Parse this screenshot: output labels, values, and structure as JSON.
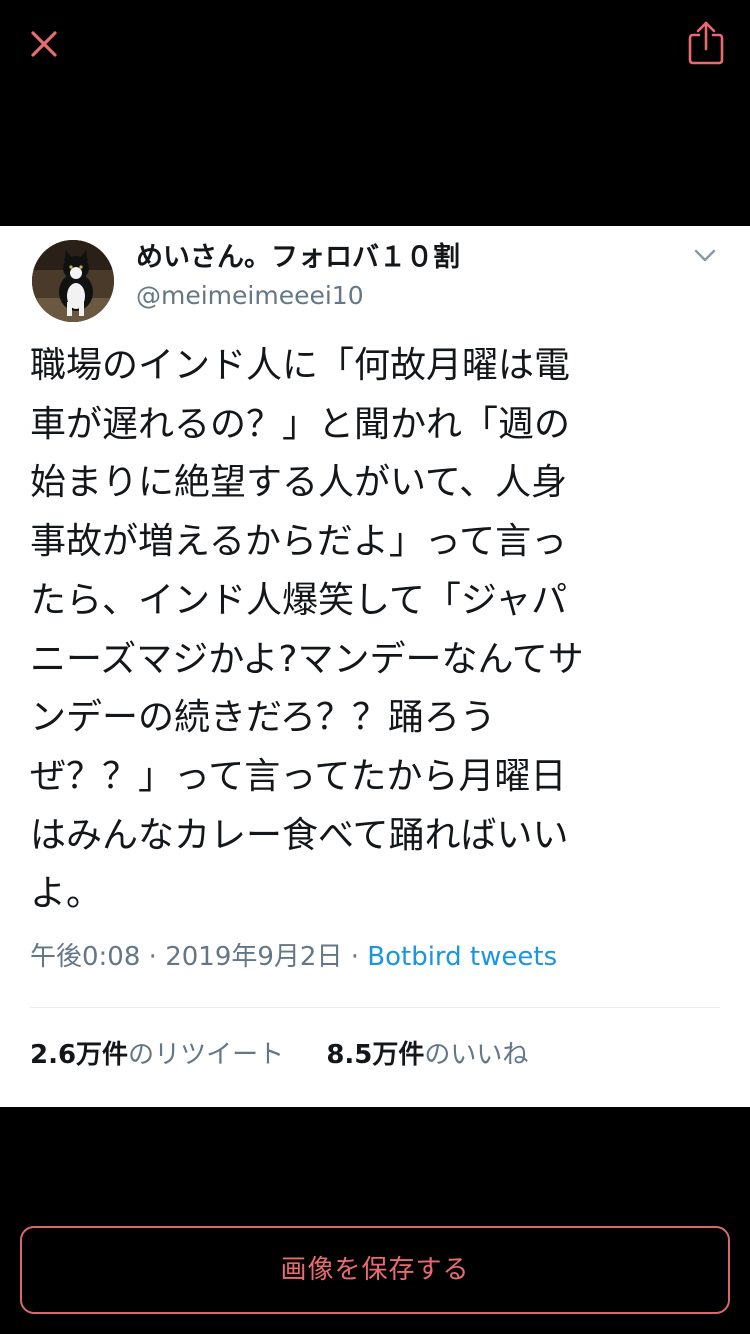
{
  "viewer": {
    "close_icon": "close-icon",
    "share_icon": "share-icon",
    "accent_color": "#ea6b6f"
  },
  "tweet": {
    "display_name": "めいさん。フォロバ１０割",
    "handle": "@meimeimeeei10",
    "text": "職場のインド人に「何故月曜は電\n車が遅れるの？」と聞かれ「週の\n始まりに絶望する人がいて、人身\n事故が増えるからだよ」って言っ\nたら、インド人爆笑して「ジャパ\nニーズマジかよ?マンデーなんてサ\nンデーの続きだろ？？踊ろう\nぜ？？」って言ってたから月曜日\nはみんなカレー食べて踊ればいい\nよ。",
    "time": "午後0:08",
    "separator": "·",
    "date": "2019年9月2日",
    "source": "Botbird tweets",
    "retweet_count": "2.6万件",
    "retweet_label": "のリツイート",
    "like_count": "8.5万件",
    "like_label": "のいいね",
    "more_icon": "chevron-down-icon",
    "link_color": "#1b95e0"
  },
  "save_button": {
    "label": "画像を保存する"
  }
}
